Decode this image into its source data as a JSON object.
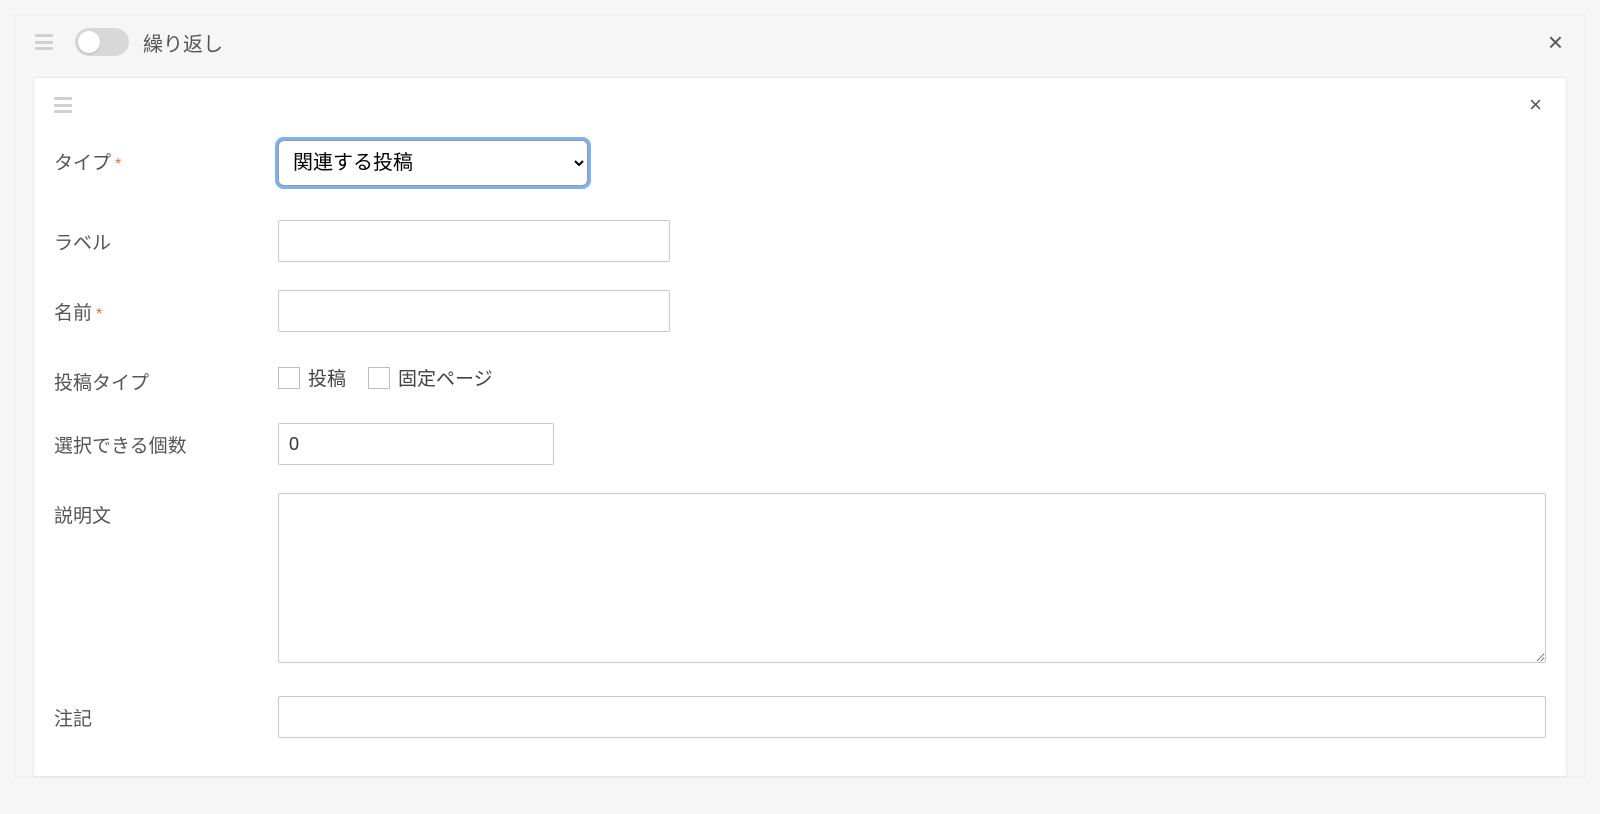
{
  "outer": {
    "toggle_label": "繰り返し",
    "toggle_on": false
  },
  "fields": {
    "type": {
      "label": "タイプ",
      "required": true,
      "selected": "関連する投稿"
    },
    "label": {
      "label": "ラベル",
      "value": ""
    },
    "name": {
      "label": "名前",
      "required": true,
      "value": ""
    },
    "post_type": {
      "label": "投稿タイプ",
      "options": [
        {
          "label": "投稿",
          "checked": false
        },
        {
          "label": "固定ページ",
          "checked": false
        }
      ]
    },
    "max_select": {
      "label": "選択できる個数",
      "value": "0"
    },
    "description": {
      "label": "説明文",
      "value": ""
    },
    "note": {
      "label": "注記",
      "value": ""
    }
  }
}
